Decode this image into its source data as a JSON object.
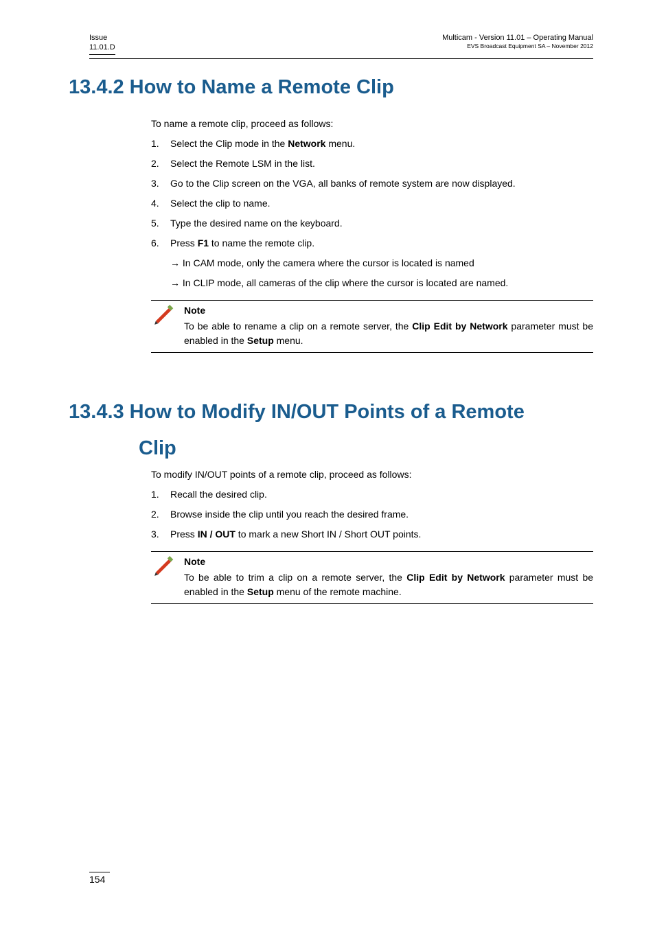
{
  "header": {
    "issue_label": "Issue",
    "issue_version": "11.01.D",
    "doc_title": "Multicam - Version 11.01 – Operating Manual",
    "doc_sub": "EVS Broadcast Equipment SA – November 2012"
  },
  "section1": {
    "title": "13.4.2 How to Name a Remote Clip",
    "intro": "To name a remote clip, proceed as follows:",
    "steps": [
      {
        "n": "1.",
        "pre": "Select the Clip mode in the ",
        "bold": "Network",
        "post": " menu."
      },
      {
        "n": "2.",
        "text": "Select the Remote LSM in the list."
      },
      {
        "n": "3.",
        "text": "Go to the Clip screen on the VGA, all banks of remote system are now displayed."
      },
      {
        "n": "4.",
        "text": "Select the clip to name."
      },
      {
        "n": "5.",
        "text": "Type the desired name on the keyboard."
      },
      {
        "n": "6.",
        "pre": "Press ",
        "bold": "F1",
        "post": " to name the remote clip."
      }
    ],
    "sub": [
      "→ In CAM mode, only the camera where the cursor is located is named",
      "→ In CLIP mode, all cameras of the clip where the cursor is located are named."
    ],
    "note": {
      "title": "Note",
      "pre": "To be able to rename a clip on a remote server, the ",
      "bold1": "Clip Edit by Network",
      "mid": " parameter must be enabled in the ",
      "bold2": "Setup",
      "post": " menu."
    }
  },
  "section2": {
    "title_line1": "13.4.3 How to Modify IN/OUT Points of a Remote",
    "title_line2": "Clip",
    "intro": "To modify IN/OUT points of a remote clip, proceed as follows:",
    "steps": [
      {
        "n": "1.",
        "text": "Recall the desired clip."
      },
      {
        "n": "2.",
        "text": "Browse inside the clip until you reach the desired frame."
      },
      {
        "n": "3.",
        "pre": "Press ",
        "bold": "IN / OUT",
        "post": " to mark a new Short IN / Short OUT points."
      }
    ],
    "note": {
      "title": "Note",
      "pre": "To be able to trim a clip on a remote server, the ",
      "bold1": "Clip Edit by Network",
      "mid": " parameter must be enabled in the ",
      "bold2": "Setup",
      "post": " menu of the remote machine."
    }
  },
  "footer": {
    "page_number": "154"
  }
}
